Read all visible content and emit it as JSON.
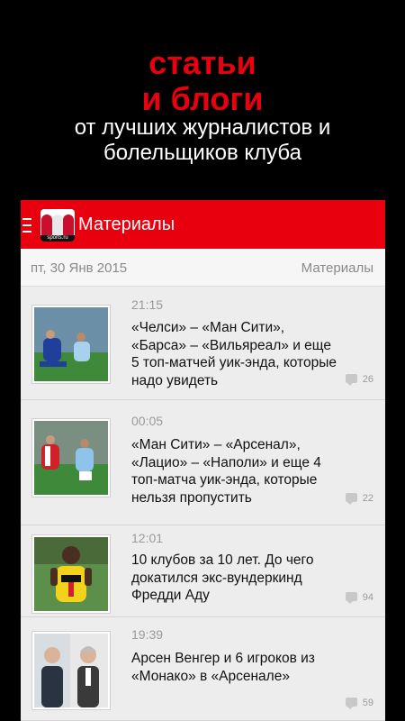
{
  "promo": {
    "title_line1": "статьи",
    "title_line2": "и блоги",
    "subtitle_line1": "от лучших журналистов и",
    "subtitle_line2": "болельщиков клуба"
  },
  "appbar": {
    "logo_text": "sports.ru",
    "title": "Материалы"
  },
  "datebar": {
    "date": "пт, 30 Янв 2015",
    "section": "Материалы"
  },
  "articles": [
    {
      "time": "21:15",
      "title": "«Челси» – «Ман Сити», «Барса» – «Вильяреал» и еще 5 топ-матчей уик-энда, которые надо увидеть",
      "comments": "26"
    },
    {
      "time": "00:05",
      "title": "«Ман Сити» – «Арсенал», «Лацио» – «Наполи» и еще 4 топ-матча уик-энда, которые нельзя пропустить",
      "comments": "22"
    },
    {
      "time": "12:01",
      "title": "10 клубов за 10 лет. До чего докатился экс-вундеркинд Фредди Аду",
      "comments": "94"
    },
    {
      "time": "19:39",
      "title": "Арсен Венгер и 6 игроков из «Монако» в «Арсенале»",
      "comments": "59"
    }
  ],
  "colors": {
    "accent": "#e8000f",
    "background": "#000000",
    "list_background": "#ededed"
  }
}
